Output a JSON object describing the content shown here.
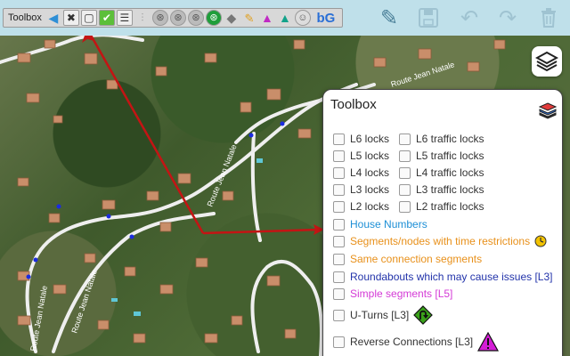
{
  "toolbar": {
    "toolbox_label": "Toolbox",
    "icons": [
      "collapse-left-icon",
      "tools-icon",
      "square-icon",
      "check-icon",
      "checklist-icon",
      "split-icon",
      "gray-a-icon",
      "gray-b-icon",
      "gray-c-icon",
      "green-circle-icon",
      "gray-square-icon",
      "brush-icon",
      "triangle-pink-icon",
      "triangle-green-icon",
      "face-icon",
      "big-icon"
    ],
    "big_label": "bG",
    "actions": [
      "pencil-icon",
      "save-icon",
      "undo-icon",
      "redo-icon",
      "trash-icon"
    ]
  },
  "map": {
    "street_labels": [
      "Route Jean Natale",
      "Route Jean Natale",
      "Route Jean Natale",
      "Route Jean Natale"
    ]
  },
  "panel": {
    "title": "Toolbox",
    "lock_pairs": [
      {
        "left": "L6 locks",
        "right": "L6 traffic locks"
      },
      {
        "left": "L5 locks",
        "right": "L5 traffic locks"
      },
      {
        "left": "L4 locks",
        "right": "L4 traffic locks"
      },
      {
        "left": "L3 locks",
        "right": "L3 traffic locks"
      },
      {
        "left": "L2 locks",
        "right": "L2 traffic locks"
      }
    ],
    "options": [
      {
        "label": "House Numbers",
        "color": "#1d8fd6"
      },
      {
        "label": "Segments/nodes with time restrictions",
        "color": "#e8901a"
      },
      {
        "label": "Same connection segments",
        "color": "#e8901a"
      },
      {
        "label": "Roundabouts which may cause issues [L3]",
        "color": "#2233aa"
      },
      {
        "label": "Simple segments [L5]",
        "color": "#d43ad6"
      },
      {
        "label": "U-Turns [L3]",
        "color": "#333333"
      },
      {
        "label": "Reverse Connections [L3]",
        "color": "#333333"
      }
    ]
  },
  "colors": {
    "toolbar_bg": "#bfe0ea",
    "arrow": "#c41414",
    "road": "#f2f2f2",
    "node": "#1a2be0"
  }
}
